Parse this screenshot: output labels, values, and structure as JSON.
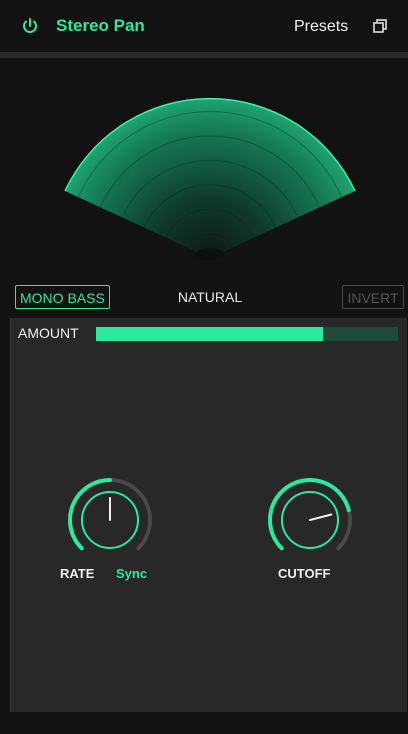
{
  "header": {
    "title": "Stereo Pan",
    "presets_label": "Presets",
    "power_icon": "power-icon",
    "copy_icon": "copy-icon"
  },
  "modes": {
    "mono_bass": "MONO BASS",
    "natural": "NATURAL",
    "invert": "INVERT"
  },
  "amount": {
    "label": "AMOUNT",
    "value": 0.75
  },
  "knobs": {
    "rate": {
      "label": "RATE",
      "sync_label": "Sync",
      "value": 0.5
    },
    "cutoff": {
      "label": "CUTOFF",
      "value": 0.78
    }
  },
  "colors": {
    "accent": "#2ee8a0",
    "track": "#1e4a3b",
    "panel": "#282828",
    "background": "#121212"
  }
}
